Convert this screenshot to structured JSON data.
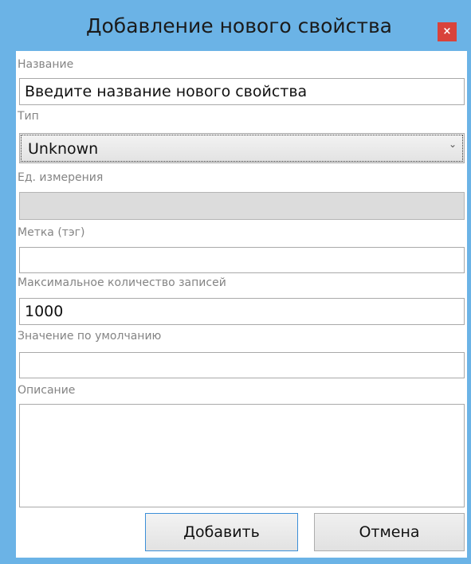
{
  "window": {
    "title": "Добавление нового свойства",
    "close_label": "×"
  },
  "form": {
    "name": {
      "label": "Название",
      "value": "Введите название нового свойства"
    },
    "type": {
      "label": "Тип",
      "selected": "Unknown",
      "chevron": "⌄"
    },
    "unit": {
      "label": "Ед. измерения",
      "value": ""
    },
    "tag": {
      "label": "Метка (тэг)",
      "value": ""
    },
    "max_records": {
      "label": "Максимальное количество записей",
      "value": "1000"
    },
    "default_value": {
      "label": "Значение по умолчанию",
      "value": ""
    },
    "description": {
      "label": "Описание",
      "value": ""
    }
  },
  "buttons": {
    "add_label": "Добавить",
    "cancel_label": "Отмена"
  },
  "colors": {
    "window_border": "#6bb3e6",
    "close_button": "#d9433b",
    "disabled_field": "#dcdcdc",
    "focus_border": "#3c8fd8"
  }
}
